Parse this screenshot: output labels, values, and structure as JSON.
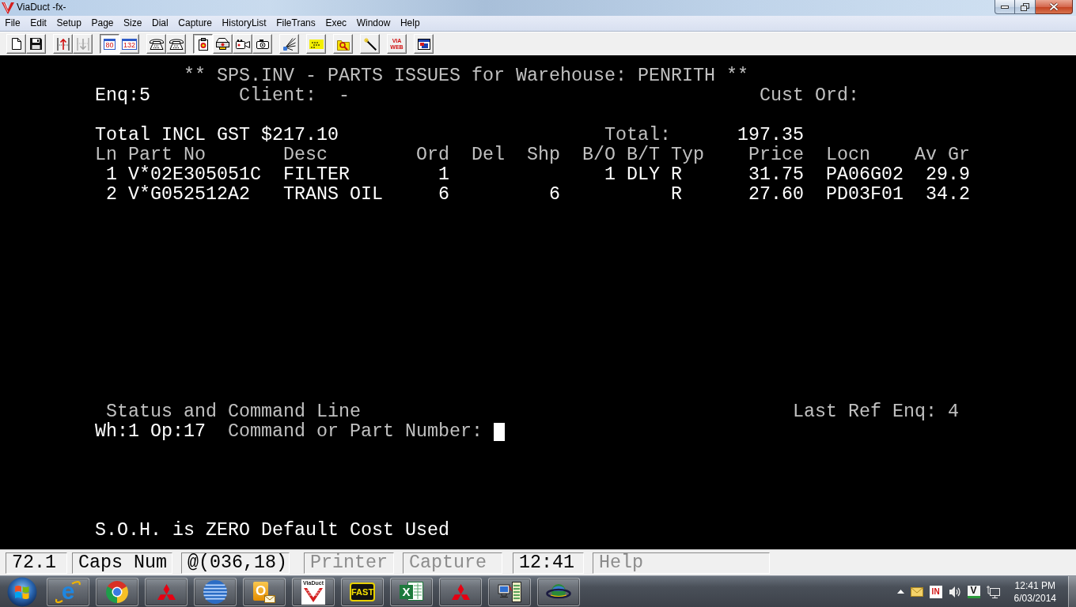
{
  "window": {
    "title": "ViaDuct -fx-"
  },
  "menu": [
    {
      "label": "File"
    },
    {
      "label": "Edit"
    },
    {
      "label": "Setup"
    },
    {
      "label": "Page"
    },
    {
      "label": "Size"
    },
    {
      "label": "Dial"
    },
    {
      "label": "Capture"
    },
    {
      "label": "HistoryList"
    },
    {
      "label": "FileTrans"
    },
    {
      "label": "Exec"
    },
    {
      "label": "Window"
    },
    {
      "label": "Help"
    }
  ],
  "toolbar": [
    [
      {
        "kind": "icon",
        "pressed": false,
        "disabled": false
      },
      {
        "kind": "icon",
        "pressed": false,
        "disabled": false
      }
    ],
    [
      {
        "kind": "icon",
        "pressed": false,
        "disabled": false
      },
      {
        "kind": "icon",
        "pressed": false,
        "disabled": true
      }
    ],
    [
      {
        "kind": "frame",
        "label": "80",
        "pressed": true,
        "disabled": false
      },
      {
        "kind": "frame",
        "label": "132",
        "pressed": false,
        "disabled": false
      }
    ],
    [
      {
        "kind": "icon",
        "pressed": false,
        "disabled": false
      },
      {
        "kind": "icon",
        "pressed": false,
        "disabled": false
      }
    ],
    [
      {
        "kind": "icon",
        "pressed": true,
        "disabled": false
      },
      {
        "kind": "icon",
        "pressed": false,
        "disabled": false
      },
      {
        "kind": "icon",
        "pressed": false,
        "disabled": false
      },
      {
        "kind": "icon",
        "pressed": false,
        "disabled": false
      }
    ],
    [
      {
        "kind": "icon",
        "pressed": false,
        "disabled": false
      }
    ],
    [
      {
        "kind": "icon",
        "pressed": false,
        "disabled": false
      }
    ],
    [
      {
        "kind": "icon",
        "pressed": false,
        "disabled": false
      }
    ],
    [
      {
        "kind": "icon",
        "pressed": false,
        "disabled": false
      }
    ],
    [
      {
        "kind": "text",
        "label": "VIA WEB",
        "pressed": false,
        "disabled": false
      }
    ],
    [
      {
        "kind": "icon",
        "pressed": false,
        "disabled": false
      }
    ]
  ],
  "screen": {
    "title": "** SPS.INV - PARTS ISSUES for Warehouse: PENRITH **",
    "enquiry": "Enq:5",
    "client_label": "Client:",
    "client": "-",
    "cust_ord_label": "Cust Ord:",
    "total_incl_gst": "Total INCL GST $217.10",
    "total_label": "Total:",
    "total": "197.35",
    "columns": [
      "Ln",
      "Part No",
      "Desc",
      "Ord",
      "Del",
      "Shp",
      "B/O",
      "B/T",
      "Typ",
      "Price",
      "Locn",
      "Av Gr"
    ],
    "rows": [
      {
        "ln": "1",
        "part_no": "V*02E305051C",
        "desc": "FILTER",
        "ord": "1",
        "bo": "1",
        "bt": "DLY",
        "typ": "R",
        "price": "31.75",
        "locn": "PA06G02",
        "av_gr": "29.9"
      },
      {
        "ln": "2",
        "part_no": "V*G052512A2",
        "desc": "TRANS OIL",
        "ord": "6",
        "shp": "6",
        "typ": "R",
        "price": "27.60",
        "locn": "PD03F01",
        "av_gr": "34.2"
      }
    ],
    "status_heading": "Status and Command Line",
    "last_ref": "Last Ref Enq: 4",
    "operator": "Wh:1 Op:17",
    "prompt": "Command or Part Number:",
    "cursor": true,
    "message": "S.O.H. is ZERO Default Cost Used"
  },
  "status_bar": [
    {
      "text": "72.1",
      "active": true
    },
    {
      "text": "Caps Num",
      "active": true
    },
    {
      "text": "@(036,18)",
      "active": true
    },
    {
      "text": "Printer",
      "active": false
    },
    {
      "text": "Capture",
      "active": false
    },
    {
      "text": "12:41",
      "active": true
    },
    {
      "text": "Help",
      "active": false
    }
  ],
  "taskbar": {
    "apps": [
      {
        "running": true,
        "glyph": "e"
      },
      {
        "running": true
      },
      {
        "running": true
      },
      {
        "running": true
      },
      {
        "running": true,
        "glyph": "O"
      },
      {
        "running": true,
        "glyph": "ViaDuct"
      },
      {
        "running": true,
        "glyph": "FAST"
      },
      {
        "running": true,
        "glyph": "X"
      },
      {
        "running": true
      },
      {
        "running": true
      },
      {
        "running": true
      }
    ],
    "tray": [
      {
        "glyph": "IN"
      },
      {
        "glyph": "V"
      }
    ],
    "time": "12:41 PM",
    "date": "6/03/2014"
  }
}
